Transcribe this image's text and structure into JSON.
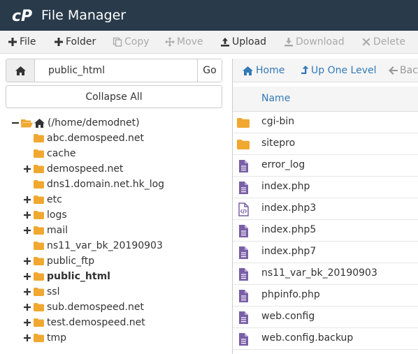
{
  "app": {
    "title": "File Manager"
  },
  "toolbar": {
    "items": [
      {
        "label": "File",
        "icon": "plus-icon",
        "enabled": true
      },
      {
        "label": "Folder",
        "icon": "plus-icon",
        "enabled": true
      },
      {
        "label": "Copy",
        "icon": "copy-icon",
        "enabled": false
      },
      {
        "label": "Move",
        "icon": "move-icon",
        "enabled": false
      },
      {
        "label": "Upload",
        "icon": "upload-icon",
        "enabled": true
      },
      {
        "label": "Download",
        "icon": "download-icon",
        "enabled": false
      },
      {
        "label": "Delete",
        "icon": "delete-icon",
        "enabled": false
      }
    ]
  },
  "pathbar": {
    "value": "public_html",
    "go_label": "Go"
  },
  "collapse_label": "Collapse All",
  "tree": {
    "root_label": "(/home/demodnet)",
    "items": [
      {
        "label": "abc.demospeed.net",
        "expandable": false,
        "bold": false
      },
      {
        "label": "cache",
        "expandable": false,
        "bold": false
      },
      {
        "label": "demospeed.net",
        "expandable": true,
        "bold": false
      },
      {
        "label": "dns1.domain.net.hk_log",
        "expandable": false,
        "bold": false
      },
      {
        "label": "etc",
        "expandable": true,
        "bold": false
      },
      {
        "label": "logs",
        "expandable": true,
        "bold": false
      },
      {
        "label": "mail",
        "expandable": true,
        "bold": false
      },
      {
        "label": "ns11_var_bk_20190903",
        "expandable": false,
        "bold": false
      },
      {
        "label": "public_ftp",
        "expandable": true,
        "bold": false
      },
      {
        "label": "public_html",
        "expandable": true,
        "bold": true
      },
      {
        "label": "ssl",
        "expandable": true,
        "bold": false
      },
      {
        "label": "sub.demospeed.net",
        "expandable": true,
        "bold": false
      },
      {
        "label": "test.demospeed.net",
        "expandable": true,
        "bold": false
      },
      {
        "label": "tmp",
        "expandable": true,
        "bold": false
      }
    ]
  },
  "nav": {
    "home": "Home",
    "up": "Up One Level",
    "back": "Bac"
  },
  "table": {
    "name_header": "Name",
    "rows": [
      {
        "name": "cgi-bin",
        "type": "folder"
      },
      {
        "name": "sitepro",
        "type": "folder"
      },
      {
        "name": "error_log",
        "type": "text"
      },
      {
        "name": "index.php",
        "type": "text"
      },
      {
        "name": "index.php3",
        "type": "code"
      },
      {
        "name": "index.php5",
        "type": "text"
      },
      {
        "name": "index.php7",
        "type": "text"
      },
      {
        "name": "ns11_var_bk_20190903",
        "type": "text"
      },
      {
        "name": "phpinfo.php",
        "type": "text"
      },
      {
        "name": "web.config",
        "type": "text"
      },
      {
        "name": "web.config.backup",
        "type": "text"
      }
    ]
  },
  "colors": {
    "titlebar": "#293a4a",
    "folder": "#f0a830",
    "file": "#7a5fa6",
    "link": "#337ab7"
  }
}
